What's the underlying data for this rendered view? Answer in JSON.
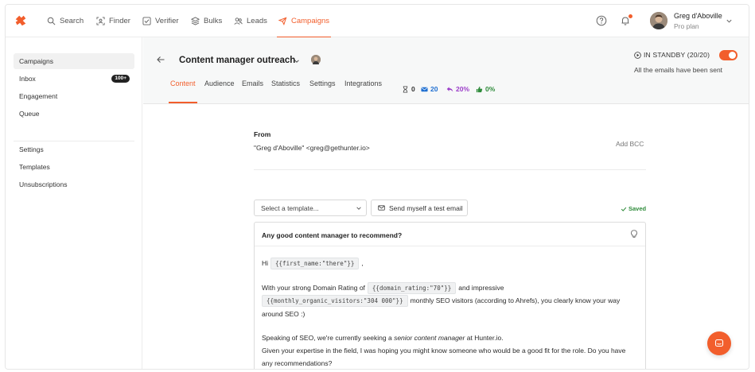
{
  "nav": {
    "items": [
      {
        "label": "Search",
        "icon": "search-icon"
      },
      {
        "label": "Finder",
        "icon": "finder-icon"
      },
      {
        "label": "Verifier",
        "icon": "verifier-icon"
      },
      {
        "label": "Bulks",
        "icon": "bulks-icon"
      },
      {
        "label": "Leads",
        "icon": "leads-icon"
      },
      {
        "label": "Campaigns",
        "icon": "campaigns-icon",
        "active": true
      }
    ],
    "user_name": "Greg d'Aboville",
    "user_plan": "Pro plan"
  },
  "sidebar": {
    "items": [
      {
        "label": "Campaigns",
        "active": true
      },
      {
        "label": "Inbox",
        "badge": "100+"
      },
      {
        "label": "Engagement"
      },
      {
        "label": "Queue"
      },
      {
        "label": "Settings"
      },
      {
        "label": "Templates"
      },
      {
        "label": "Unsubscriptions"
      }
    ]
  },
  "campaign": {
    "title": "Content manager outreach",
    "tabs": [
      "Content",
      "Audience",
      "Emails",
      "Statistics",
      "Settings",
      "Integrations"
    ],
    "active_tab": "Content",
    "stats": {
      "pending": "0",
      "sent": "20",
      "replies": "20%",
      "interested": "0%"
    },
    "status": "IN STANDBY (20/20)",
    "status_sub": "All the emails have been sent"
  },
  "email": {
    "from_label": "From",
    "from_value": "\"Greg d'Aboville\" <greg@gethunter.io>",
    "add_bcc": "Add BCC",
    "template_placeholder": "Select a template...",
    "test_button": "Send myself a test email",
    "saved": "Saved",
    "subject": "Any good content manager to recommend?",
    "body": {
      "greeting": "Hi",
      "var_first_name": "{{first_name:\"there\"}}",
      "greeting_end": ",",
      "line2_a": "With your strong Domain Rating of",
      "var_domain_rating": "{{domain_rating:\"70\"}}",
      "line2_b": "and impressive",
      "var_traffic": "{{monthly_organic_visitors:\"304 000\"}}",
      "line3_b": "monthly SEO visitors (according to Ahrefs), you clearly know your way",
      "line4": "around SEO :)",
      "line5_a": "Speaking of SEO, we're currently seeking a",
      "line5_em": "senior content manager",
      "line5_b": "at Hunter.io.",
      "line6": "Given your expertise in the field, I was hoping you might know someone who would be a good fit for the role. Do you have",
      "line7": "any recommendations?"
    }
  },
  "colors": {
    "accent": "#f25e2c",
    "saved_green": "#2e8b3a",
    "sent_blue": "#1f6fd1",
    "reply_purple": "#9b3dc8",
    "interest_green": "#2e8b3a"
  }
}
